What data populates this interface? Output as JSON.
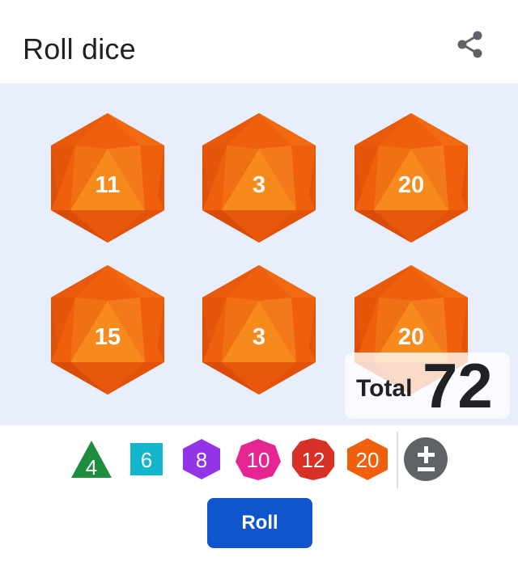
{
  "header": {
    "title": "Roll dice",
    "share_icon": "share-icon"
  },
  "colors": {
    "board_bg": "#e8eefb",
    "d20_main": "#f0600c",
    "d20_light": "#f5851a",
    "d20_dark": "#d4480a",
    "roll_button": "#1155cc"
  },
  "dice": [
    {
      "type": "d20",
      "value": "11"
    },
    {
      "type": "d20",
      "value": "3"
    },
    {
      "type": "d20",
      "value": "20"
    },
    {
      "type": "d20",
      "value": "15"
    },
    {
      "type": "d20",
      "value": "3"
    },
    {
      "type": "d20",
      "value": "20"
    }
  ],
  "total": {
    "label": "Total",
    "value": "72"
  },
  "die_types": [
    {
      "label": "4",
      "color": "#1e8e3e",
      "icon": "tetrahedron-icon"
    },
    {
      "label": "6",
      "color": "#12b5cb",
      "icon": "cube-icon"
    },
    {
      "label": "8",
      "color": "#9334e6",
      "icon": "octahedron-icon"
    },
    {
      "label": "10",
      "color": "#e52592",
      "icon": "decahedron-icon"
    },
    {
      "label": "12",
      "color": "#d93025",
      "icon": "dodecahedron-icon"
    },
    {
      "label": "20",
      "color": "#f0600c",
      "icon": "icosahedron-icon"
    }
  ],
  "modifier": {
    "icon": "plus-minus-icon",
    "color": "#5f6368"
  },
  "roll_button": {
    "label": "Roll"
  }
}
